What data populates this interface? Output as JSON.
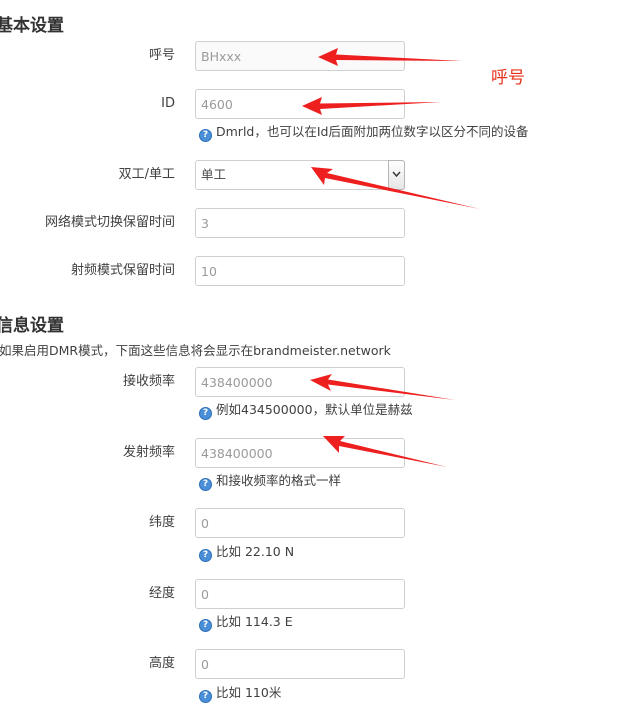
{
  "basic_section": {
    "title": "基本设置",
    "fields": {
      "callsign": {
        "label": "呼号",
        "placeholder": "BHxxx"
      },
      "id": {
        "label": "ID",
        "placeholder": "4600",
        "help": "Dmrld，也可以在Id后面附加两位数字以区分不同的设备"
      },
      "duplex": {
        "label": "双工/单工",
        "value": "单工"
      },
      "net_hold": {
        "label": "网络模式切换保留时间",
        "placeholder": "3"
      },
      "rf_hold": {
        "label": "射频模式保留时间",
        "placeholder": "10"
      }
    }
  },
  "info_section": {
    "title": "信息设置",
    "description": "如果启用DMR模式，下面这些信息将会显示在brandmeister.network",
    "fields": {
      "rx_freq": {
        "label": "接收频率",
        "placeholder": "438400000",
        "help": "例如434500000，默认单位是赫兹"
      },
      "tx_freq": {
        "label": "发射频率",
        "placeholder": "438400000",
        "help": "和接收频率的格式一样"
      },
      "latitude": {
        "label": "纬度",
        "placeholder": "0",
        "help": "比如 22.10 N"
      },
      "longitude": {
        "label": "经度",
        "placeholder": "0",
        "help": "比如 114.3 E"
      },
      "altitude": {
        "label": "高度",
        "placeholder": "0",
        "help": "比如 110米"
      }
    }
  },
  "annotation": {
    "text": "呼号",
    "color": "#e8331b"
  },
  "icons": {
    "help": "question-circle-icon",
    "dropdown": "chevron-down-icon"
  }
}
